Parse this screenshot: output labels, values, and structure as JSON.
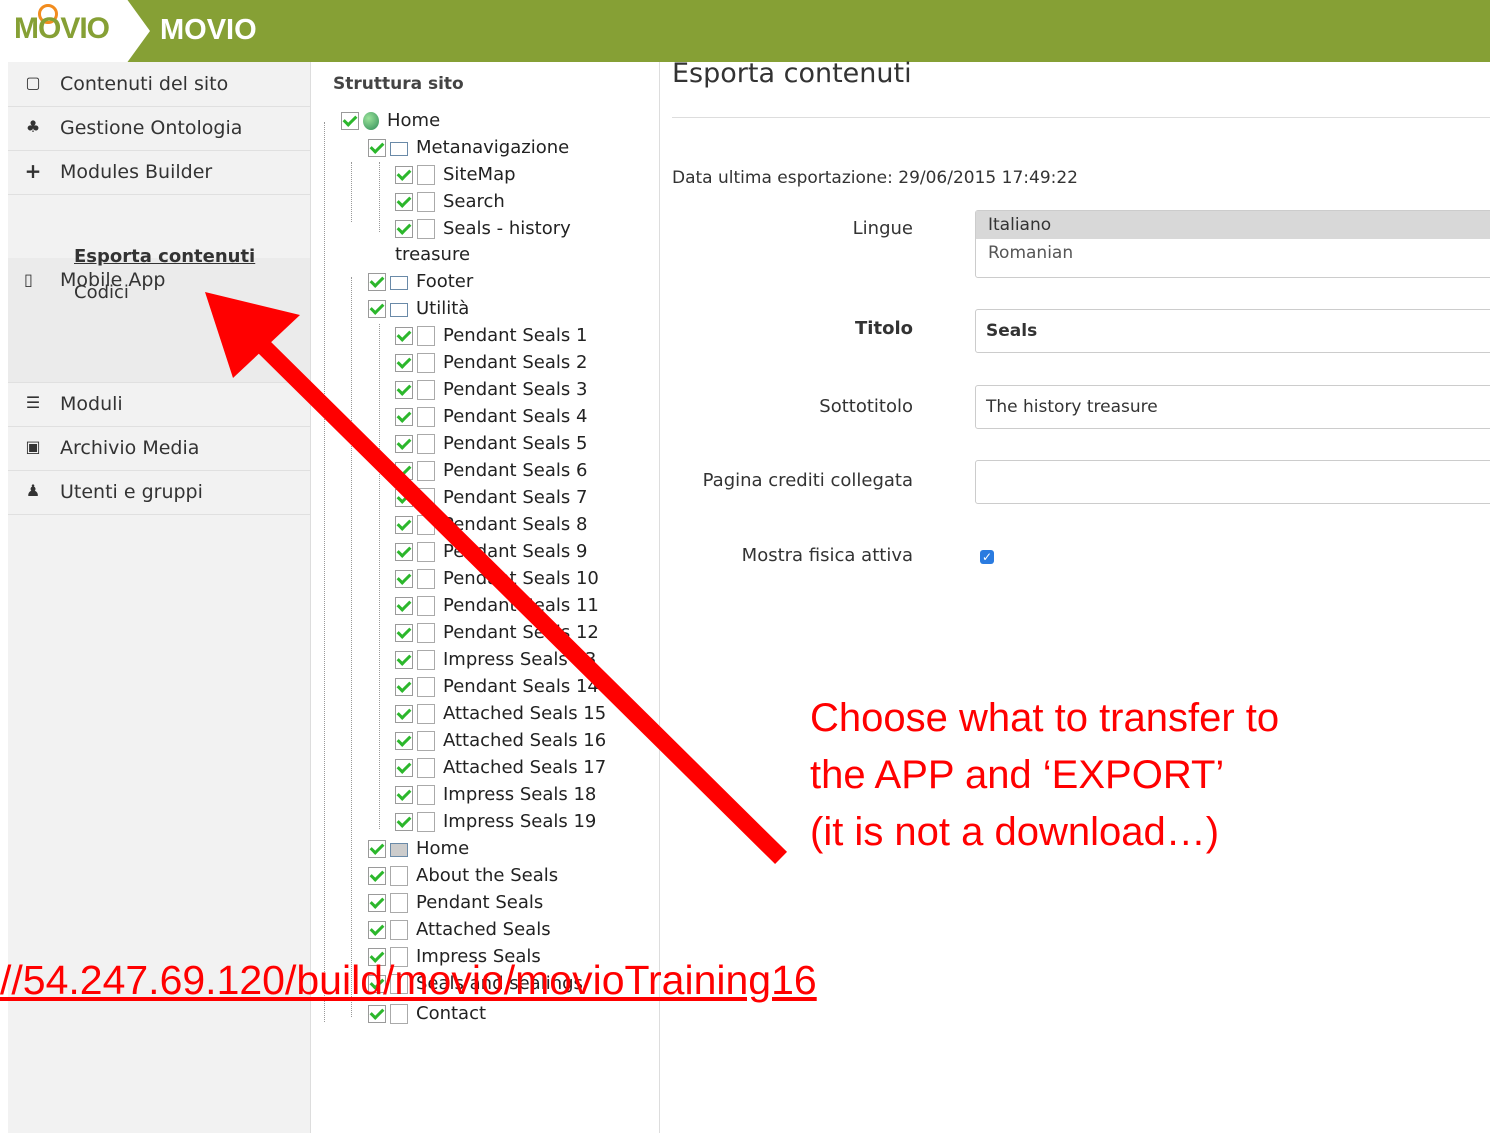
{
  "header": {
    "logo_text": "MOVIO",
    "app_title": "MOVIO",
    "brand_color": "#86a035"
  },
  "sidebar": {
    "items": [
      {
        "label": "Contenuti del sito",
        "icon": "document-icon"
      },
      {
        "label": "Gestione Ontologia",
        "icon": "sitemap-icon"
      },
      {
        "label": "Modules Builder",
        "icon": "plus-icon"
      },
      {
        "label": "Mobile App",
        "icon": "mobile-icon"
      },
      {
        "label": "Moduli",
        "icon": "list-icon"
      },
      {
        "label": "Archivio Media",
        "icon": "image-icon"
      },
      {
        "label": "Utenti e gruppi",
        "icon": "user-icon"
      }
    ],
    "mobile_sub": [
      "Esporta contenuti",
      "Codici"
    ]
  },
  "tree": {
    "title": "Struttura sito",
    "nodes": [
      {
        "label": "Home",
        "icon": "globe-icon"
      },
      {
        "label": "Metanavigazione",
        "icon": "folder-icon"
      },
      {
        "label": "SiteMap",
        "icon": "page-icon"
      },
      {
        "label": "Search",
        "icon": "page-icon"
      },
      {
        "label": "Seals - history",
        "icon": "page-icon"
      },
      {
        "label": "treasure",
        "icon": ""
      },
      {
        "label": "Footer",
        "icon": "folder-icon"
      },
      {
        "label": "Utilità",
        "icon": "folder-icon"
      },
      {
        "label": "Pendant Seals 1",
        "icon": "page-icon"
      },
      {
        "label": "Pendant Seals 2",
        "icon": "page-icon"
      },
      {
        "label": "Pendant Seals 3",
        "icon": "page-icon"
      },
      {
        "label": "Pendant Seals 4",
        "icon": "page-icon"
      },
      {
        "label": "Pendant Seals 5",
        "icon": "page-icon"
      },
      {
        "label": "Pendant Seals 6",
        "icon": "page-icon"
      },
      {
        "label": "Pendant Seals 7",
        "icon": "page-icon"
      },
      {
        "label": "Pendant Seals 8",
        "icon": "page-icon"
      },
      {
        "label": "Pendant Seals 9",
        "icon": "page-icon"
      },
      {
        "label": "Pendant Seals 10",
        "icon": "page-icon"
      },
      {
        "label": "Pendant Seals 11",
        "icon": "page-icon"
      },
      {
        "label": "Pendant Seals 12",
        "icon": "page-icon"
      },
      {
        "label": "Impress Seals 13",
        "icon": "page-icon"
      },
      {
        "label": "Pendant Seals 14",
        "icon": "page-icon"
      },
      {
        "label": "Attached Seals 15",
        "icon": "page-icon"
      },
      {
        "label": "Attached Seals 16",
        "icon": "page-icon"
      },
      {
        "label": "Attached Seals 17",
        "icon": "page-icon"
      },
      {
        "label": "Impress Seals 18",
        "icon": "page-icon"
      },
      {
        "label": "Impress Seals 19",
        "icon": "page-icon"
      },
      {
        "label": "Home",
        "icon": "folder-icon"
      },
      {
        "label": "About the Seals",
        "icon": "page-icon"
      },
      {
        "label": "Pendant Seals",
        "icon": "page-icon"
      },
      {
        "label": "Attached Seals",
        "icon": "page-icon"
      },
      {
        "label": "Impress Seals",
        "icon": "page-icon"
      },
      {
        "label": "Seals and sealings",
        "icon": "page-icon"
      },
      {
        "label": "Contact",
        "icon": "page-icon"
      }
    ]
  },
  "main": {
    "title": "Esporta contenuti",
    "export_date": "Data ultima esportazione: 29/06/2015 17:49:22",
    "labels": {
      "lingue": "Lingue",
      "titolo": "Titolo",
      "sottotitolo": "Sottotitolo",
      "pagina_crediti": "Pagina crediti collegata",
      "mostra_fisica": "Mostra fisica attiva"
    },
    "lingue_options": [
      "Italiano",
      "Romanian"
    ],
    "lingue_selected": "Italiano",
    "titolo_value": "Seals",
    "sottotitolo_value": "The history treasure",
    "pagina_crediti_value": "",
    "mostra_fisica_checked": true
  },
  "annotation": {
    "text": "Choose what to transfer to\nthe APP and ‘EXPORT’\n(it is not a download…)",
    "url": "//54.247.69.120/build/movio/movioTraining16",
    "color": "#ff0000"
  }
}
